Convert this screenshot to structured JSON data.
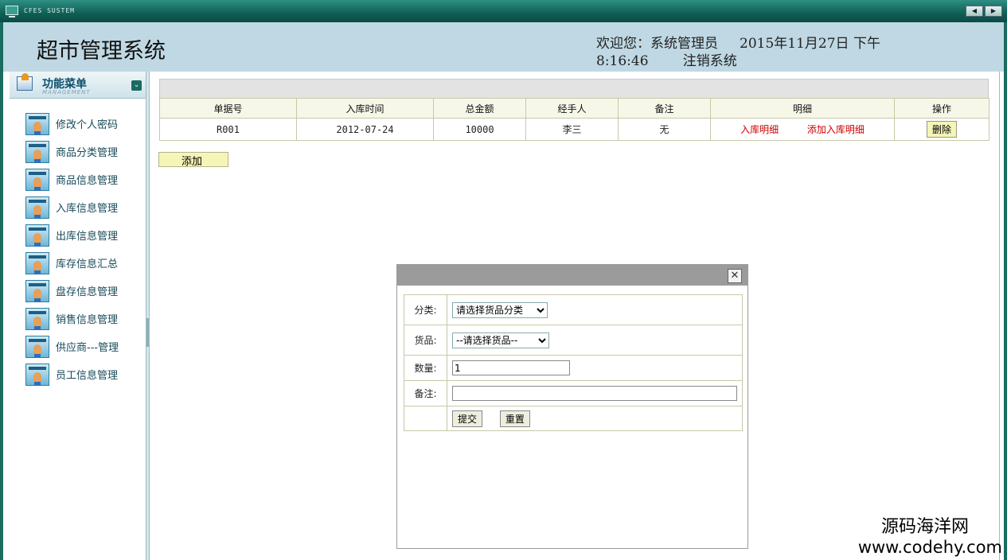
{
  "window": {
    "brand": "CFES SUSTEM",
    "nav_prev": "◀",
    "nav_next": "▶"
  },
  "header": {
    "title": "超市管理系统",
    "welcome": "欢迎您：系统管理员",
    "date": "2015年11月27日 下午",
    "time": "8:16:46",
    "logout": "注销系统"
  },
  "menu": {
    "title": "功能菜单",
    "subtitle": "MANAGEMENT",
    "collapse_glyph": "⌄",
    "items": [
      {
        "label": "修改个人密码"
      },
      {
        "label": "商品分类管理"
      },
      {
        "label": "商品信息管理"
      },
      {
        "label": "入库信息管理"
      },
      {
        "label": "出库信息管理"
      },
      {
        "label": "库存信息汇总"
      },
      {
        "label": "盘存信息管理"
      },
      {
        "label": "销售信息管理"
      },
      {
        "label": "供应商---管理"
      },
      {
        "label": "员工信息管理"
      }
    ]
  },
  "table": {
    "columns": [
      "单据号",
      "入库时间",
      "总金额",
      "经手人",
      "备注",
      "明细",
      "操作"
    ],
    "rows": [
      {
        "id": "R001",
        "date": "2012-07-24",
        "total": "10000",
        "handler": "李三",
        "remark": "无",
        "detail_link": "入库明细",
        "add_detail_link": "添加入库明细",
        "delete_label": "删除"
      }
    ]
  },
  "add_button": "添加",
  "dialog": {
    "close_glyph": "✕",
    "category_label": "分类:",
    "category_selected": "请选择货品分类",
    "goods_label": "货品:",
    "goods_selected": "--请选择货品--",
    "quantity_label": "数量:",
    "quantity_value": "1",
    "remark_label": "备注:",
    "remark_value": "",
    "submit_label": "提交",
    "reset_label": "重置"
  },
  "watermark": {
    "line1": "源码海洋网",
    "line2": "www.codehy.com"
  },
  "colors": {
    "frame": "#1a6b60",
    "header_bg": "#bfd8e3",
    "link": "#cc0000",
    "button_bg": "#f5f5b8"
  }
}
